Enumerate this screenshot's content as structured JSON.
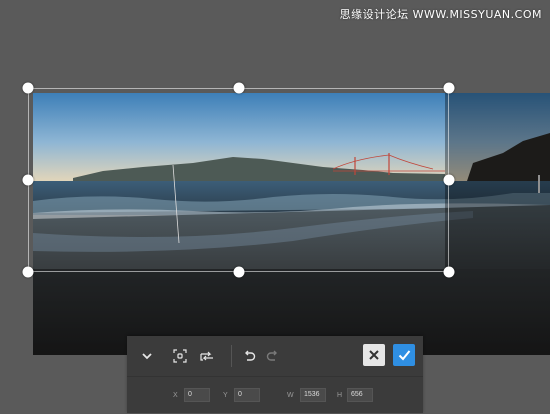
{
  "watermark": {
    "text": "思缘设计论坛 WWW.MISSYUAN.COM"
  },
  "photo": {
    "description_icon": "photo"
  },
  "toolbar": {
    "tools": [
      {
        "icon": "chevron-down-icon"
      },
      {
        "icon": "crop-fit-icon"
      },
      {
        "icon": "rotate-crop-icon"
      },
      {
        "icon": "undo-icon"
      },
      {
        "icon": "redo-icon"
      }
    ],
    "cancel_icon": "close-icon",
    "confirm_icon": "check-icon"
  },
  "fields": {
    "x": {
      "label": "X",
      "value": "0"
    },
    "y": {
      "label": "Y",
      "value": "0"
    },
    "w": {
      "label": "W",
      "value": "1536"
    },
    "h": {
      "label": "H",
      "value": "656"
    }
  },
  "colors": {
    "background": "#5a5a5a",
    "toolbar": "#3b3b3b",
    "confirm": "#2f8fe3",
    "cancel": "#e6e6e6"
  }
}
